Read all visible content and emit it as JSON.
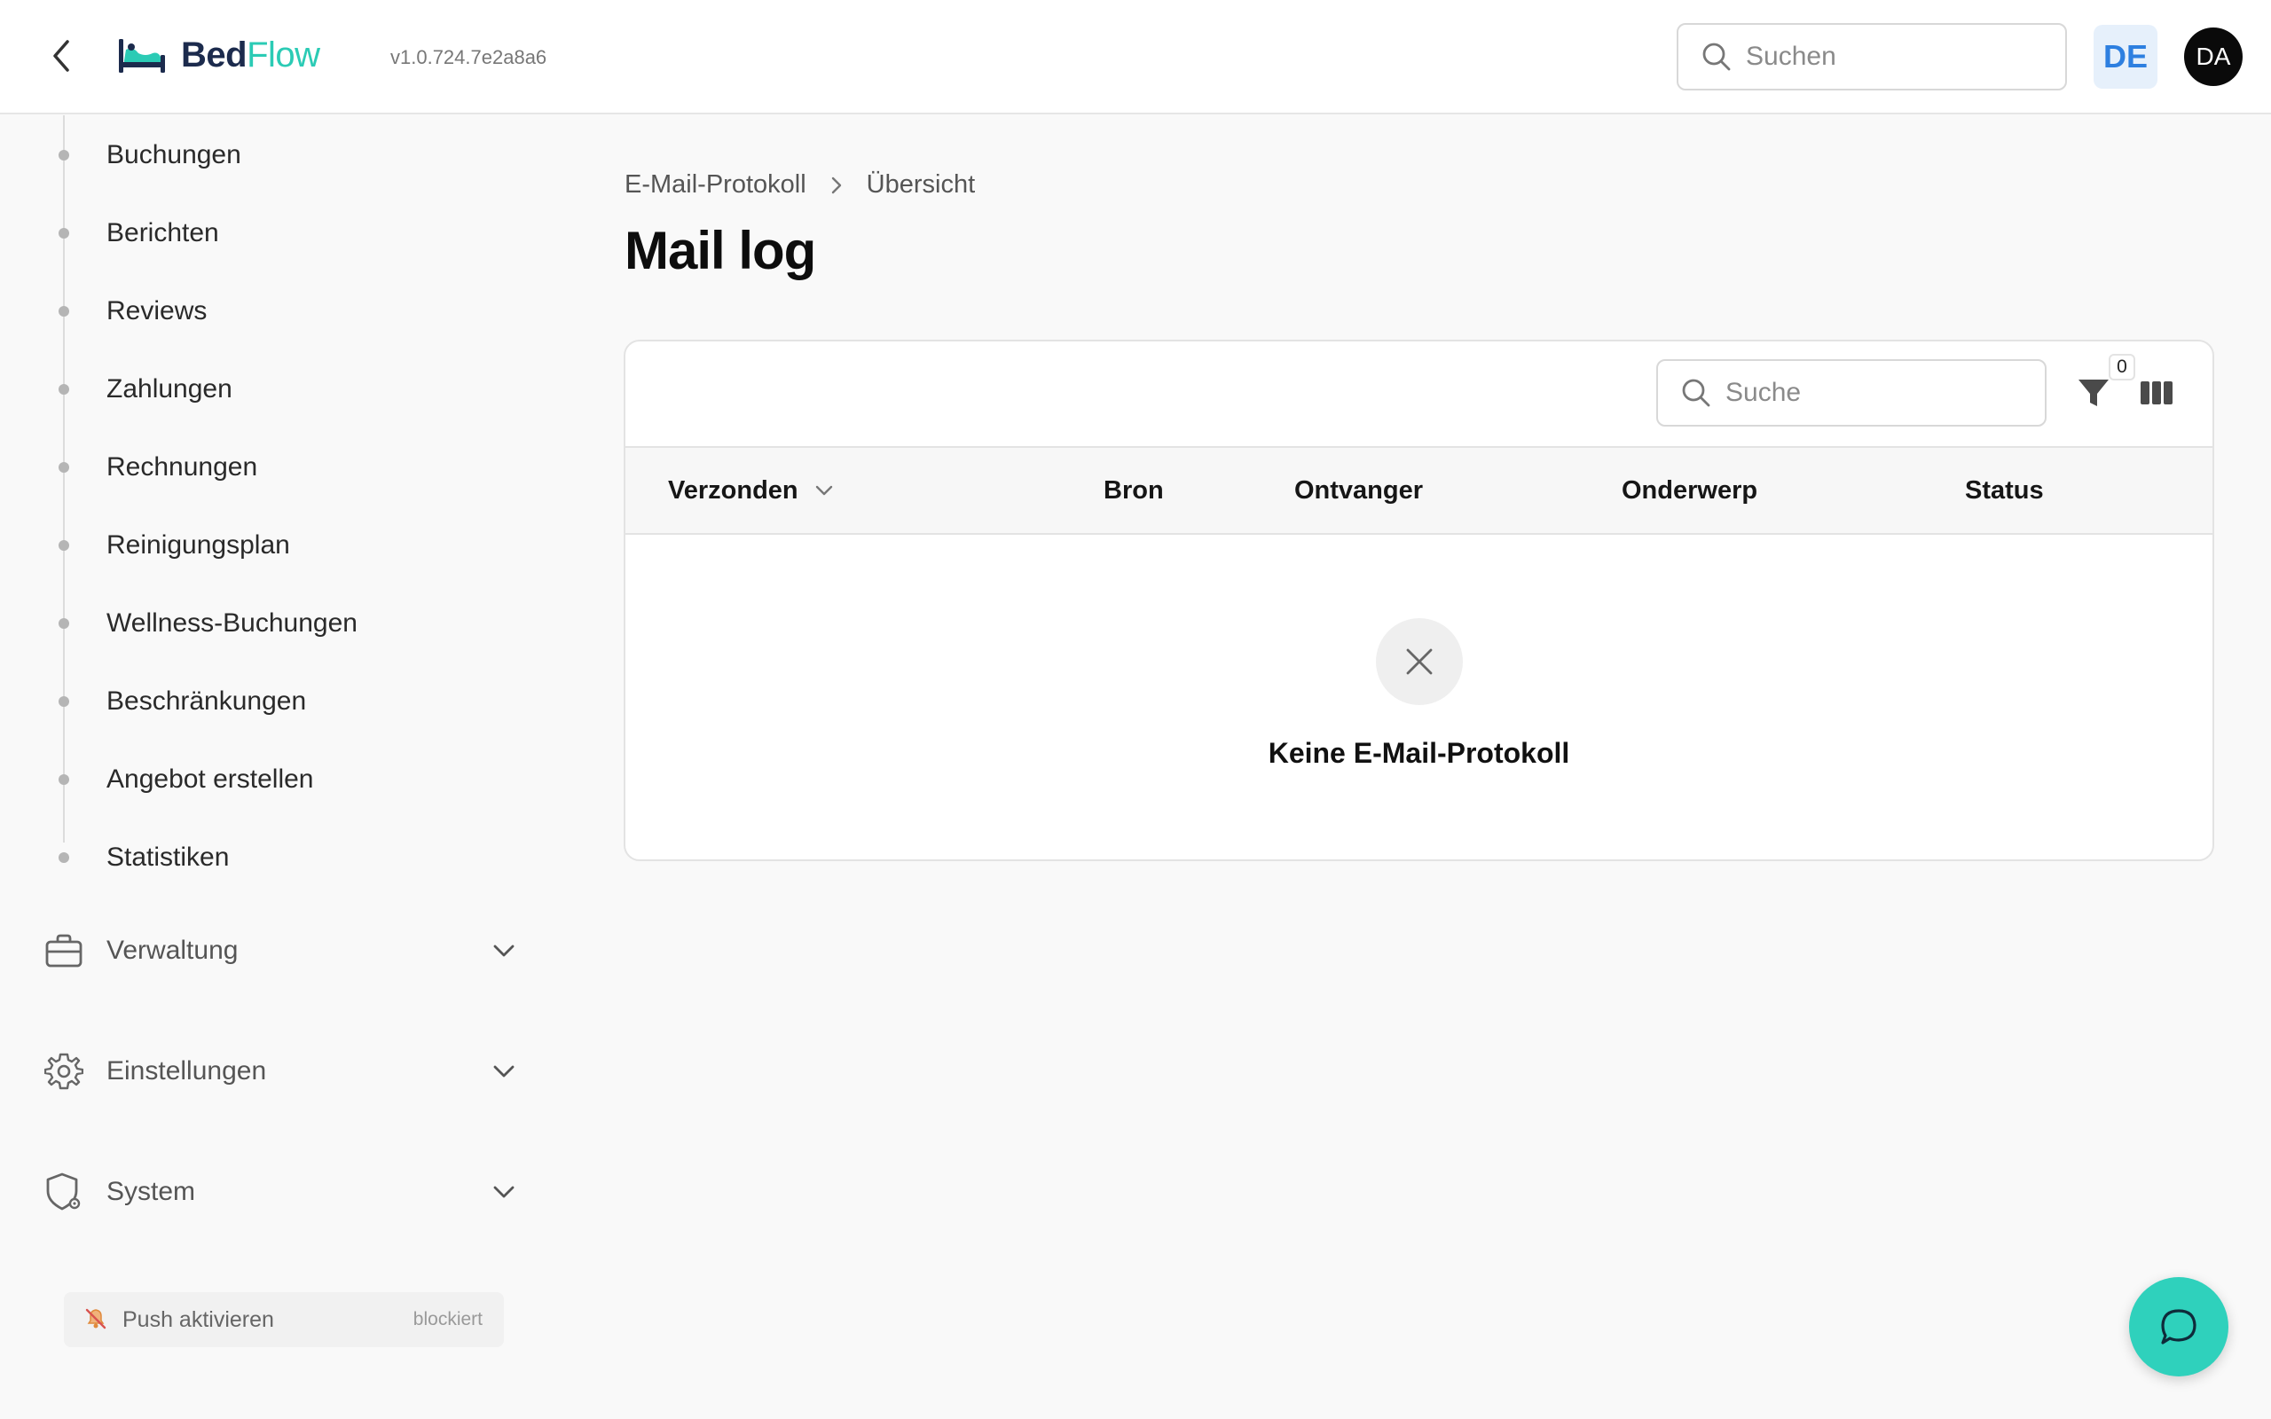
{
  "app": {
    "logo_bed": "Bed",
    "logo_flow": "Flow",
    "version": "v1.0.724.7e2a8a6",
    "search_placeholder": "Suchen",
    "language": "DE",
    "user_initials": "DA"
  },
  "sidebar": {
    "sub_items": [
      {
        "label": "Buchungen"
      },
      {
        "label": "Berichten"
      },
      {
        "label": "Reviews"
      },
      {
        "label": "Zahlungen"
      },
      {
        "label": "Rechnungen"
      },
      {
        "label": "Reinigungsplan"
      },
      {
        "label": "Wellness-Buchungen"
      },
      {
        "label": "Beschränkungen"
      },
      {
        "label": "Angebot erstellen"
      },
      {
        "label": "Statistiken"
      }
    ],
    "groups": [
      {
        "label": "Verwaltung",
        "icon": "briefcase-icon"
      },
      {
        "label": "Einstellungen",
        "icon": "gear-icon"
      },
      {
        "label": "System",
        "icon": "shield-gear-icon"
      }
    ],
    "push": {
      "label": "Push aktivieren",
      "state": "blockiert",
      "icon": "bell-off-icon"
    }
  },
  "main": {
    "breadcrumb": [
      "E-Mail-Protokoll",
      "Übersicht"
    ],
    "title": "Mail log",
    "table": {
      "search_placeholder": "Suche",
      "filter_count": "0",
      "columns": [
        "Verzonden",
        "Bron",
        "Ontvanger",
        "Onderwerp",
        "Status"
      ],
      "empty_text": "Keine E-Mail-Protokoll"
    }
  },
  "colors": {
    "accent": "#2bcbb5",
    "brand_dark": "#1c2b4d",
    "lang_blue": "#2d7fe0"
  }
}
